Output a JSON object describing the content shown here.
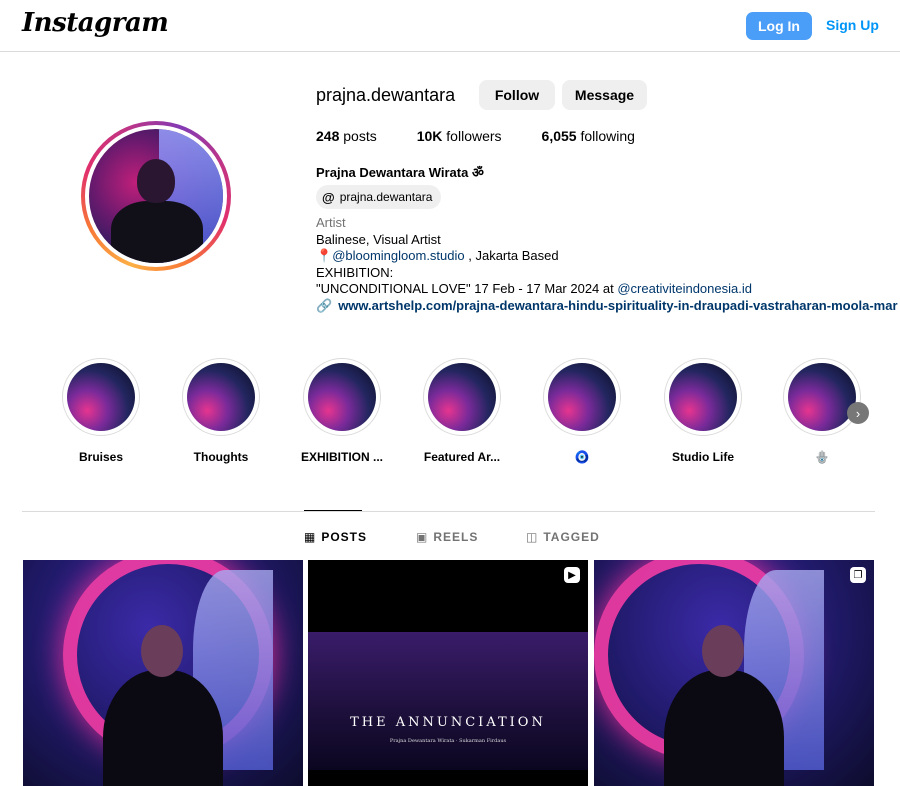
{
  "header": {
    "logo": "Instagram",
    "login_label": "Log In",
    "signup_label": "Sign Up"
  },
  "profile": {
    "username": "prajna.dewantara",
    "follow_label": "Follow",
    "message_label": "Message",
    "posts_count": "248",
    "posts_label": " posts",
    "followers_count": "10K",
    "followers_label": " followers",
    "following_count": "6,055",
    "following_label": " following",
    "full_name": "Prajna Dewantara Wirata ॐ",
    "threads_handle": "prajna.dewantara",
    "category": "Artist",
    "bio_line1": "Balinese, Visual Artist",
    "bio_line2_mention": "@bloomingloom.studio",
    "bio_line2_rest": " , Jakarta Based",
    "bio_line3": "EXHIBITION:",
    "bio_line4_text": "\"UNCONDITIONAL LOVE\" 17 Feb - 17 Mar 2024 at ",
    "bio_line4_mention": "@creativiteindonesia.id",
    "link": "www.artshelp.com/prajna-dewantara-hindu-spirituality-in-draupadi-vastraharan-moola-mar"
  },
  "highlights": [
    {
      "label": "Bruises"
    },
    {
      "label": "Thoughts"
    },
    {
      "label": "EXHIBITION ..."
    },
    {
      "label": "Featured Ar..."
    },
    {
      "label": "🧿"
    },
    {
      "label": "Studio Life"
    },
    {
      "label": "🪬"
    }
  ],
  "tabs": [
    {
      "label": "POSTS",
      "icon": "grid-icon"
    },
    {
      "label": "REELS",
      "icon": "reels-icon"
    },
    {
      "label": "TAGGED",
      "icon": "tagged-icon"
    }
  ],
  "posts": [
    {
      "type": "photo"
    },
    {
      "type": "reel",
      "title": "THE ANNUNCIATION",
      "credits": "Prajna Dewantara Wirata · Sukarman Firdaus"
    },
    {
      "type": "carousel"
    }
  ]
}
